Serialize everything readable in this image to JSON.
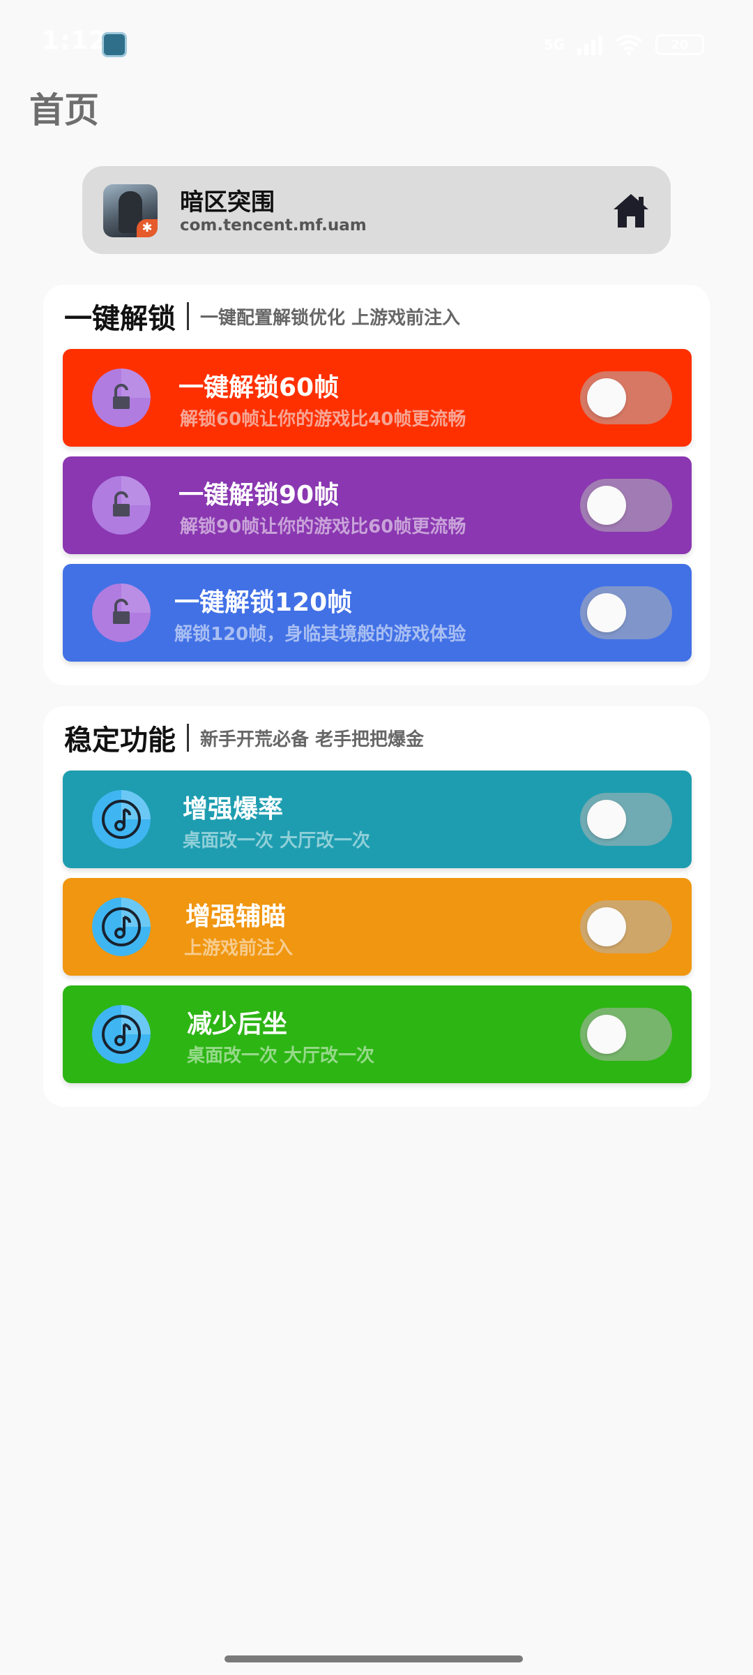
{
  "status_bar": {
    "time": "1:12",
    "network": "5G",
    "battery": "20"
  },
  "page": {
    "title": "首页"
  },
  "app": {
    "name": "暗区突围",
    "package": "com.tencent.mf.uam",
    "icon": "game-app-icon",
    "home_icon": "home-icon"
  },
  "sections": [
    {
      "title": "一键解锁",
      "subtitle": "一键配置解锁优化 上游戏前注入",
      "items": [
        {
          "title": "一键解锁60帧",
          "desc": "解锁60帧让你的游戏比40帧更流畅",
          "color": "#ff3000",
          "desc_color": "#f6a595",
          "icon": "unlock-icon",
          "enabled": false
        },
        {
          "title": "一键解锁90帧",
          "desc": "解锁90帧让你的游戏比60帧更流畅",
          "color": "#8a37b1",
          "desc_color": "#c9a3d9",
          "icon": "unlock-icon",
          "enabled": false
        },
        {
          "title": "一键解锁120帧",
          "desc": "解锁120帧，身临其境般的游戏体验",
          "color": "#4271e6",
          "desc_color": "#a9bff2",
          "icon": "unlock-icon",
          "enabled": false
        }
      ]
    },
    {
      "title": "稳定功能",
      "subtitle": "新手开荒必备 老手把把爆金",
      "items": [
        {
          "title": "增强爆率",
          "desc": "桌面改一次 大厅改一次",
          "color": "#1e9db0",
          "desc_color": "#8fcfd8",
          "icon": "music-disc-icon",
          "enabled": false
        },
        {
          "title": "增强辅瞄",
          "desc": "上游戏前注入",
          "color": "#f09610",
          "desc_color": "#f7cc8f",
          "icon": "music-disc-icon",
          "enabled": false
        },
        {
          "title": "减少后坐",
          "desc": "桌面改一次 大厅改一次",
          "color": "#2db514",
          "desc_color": "#96da8a",
          "icon": "music-disc-icon",
          "enabled": false
        }
      ]
    }
  ]
}
